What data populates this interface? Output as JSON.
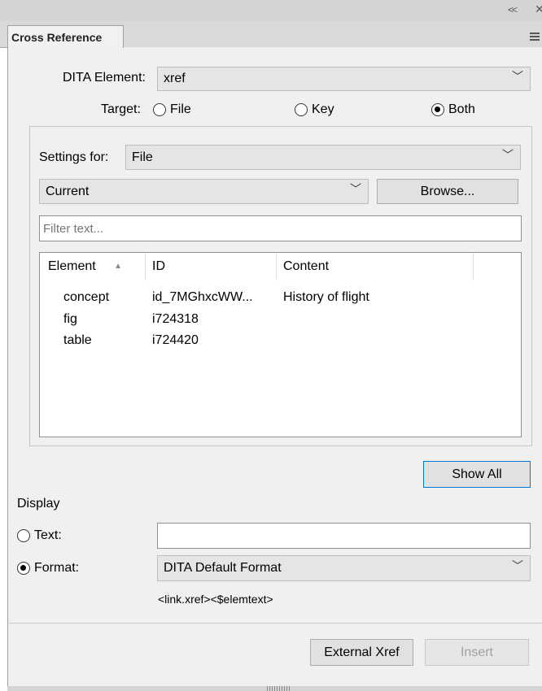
{
  "panel": {
    "tab_title": "Cross Reference"
  },
  "dita_element": {
    "label": "DITA Element:",
    "value": "xref"
  },
  "target": {
    "label": "Target:",
    "options": [
      {
        "label": "File",
        "selected": false
      },
      {
        "label": "Key",
        "selected": false
      },
      {
        "label": "Both",
        "selected": true
      }
    ]
  },
  "settings": {
    "label": "Settings for:",
    "value": "File",
    "scope_value": "Current",
    "browse_label": "Browse...",
    "filter_placeholder": "Filter text..."
  },
  "table": {
    "columns": [
      "Element",
      "ID",
      "Content"
    ],
    "sort_indicator": "▲",
    "rows": [
      {
        "element": "concept",
        "id": "id_7MGhxcWW...",
        "content": "History of flight"
      },
      {
        "element": "fig",
        "id": "i724318",
        "content": ""
      },
      {
        "element": "table",
        "id": "i724420",
        "content": ""
      }
    ]
  },
  "show_all_label": "Show All",
  "display": {
    "title": "Display",
    "text_label": "Text:",
    "text_value": "",
    "text_selected": false,
    "format_label": "Format:",
    "format_selected": true,
    "format_value": "DITA Default Format",
    "format_preview": "<link.xref><$elemtext>"
  },
  "footer": {
    "external_xref_label": "External Xref",
    "insert_label": "Insert"
  },
  "colors": {
    "chrome": "#d4d4d4",
    "panel": "#f0f0f0",
    "focus_border": "#0078d7",
    "disabled_text": "#a0a0a0"
  }
}
